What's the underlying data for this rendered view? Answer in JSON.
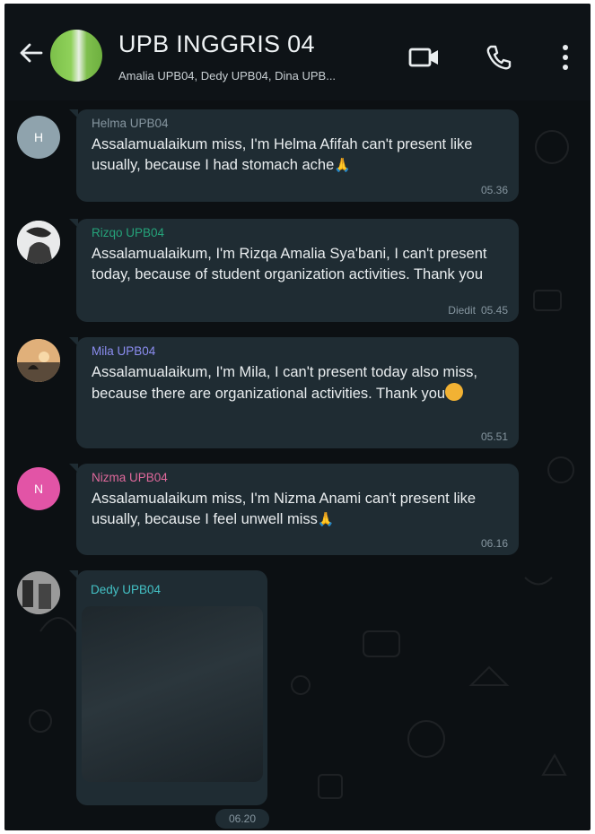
{
  "header": {
    "title": "UPB INGGRIS 04",
    "subtitle": "Amalia UPB04, Dedy UPB04, Dina UPB...",
    "icons": {
      "back": "back-arrow-icon",
      "video": "video-call-icon",
      "call": "voice-call-icon",
      "menu": "more-options-icon"
    }
  },
  "messages": [
    {
      "sender": "Helma UPB04",
      "sender_color": "#8696a0",
      "avatar_initial": "H",
      "avatar_color": "#8fa3ad",
      "text": "Assalamualaikum miss, I'm Helma Afifah can't present like usually, because I had stomach ache",
      "emoji": "🙏",
      "edited": "",
      "time": "05.36"
    },
    {
      "sender": "Rizqo UPB04",
      "sender_color": "#25a37a",
      "avatar_initial": "",
      "text": "Assalamualaikum, I'm Rizqa Amalia Sya'bani, I can't present today, because of student organization activities. Thank you",
      "edited": "Diedit",
      "time": "05.45"
    },
    {
      "sender": "Mila UPB04",
      "sender_color": "#8b8df0",
      "avatar_initial": "",
      "text": "Assalamualaikum, I'm Mila, I can't present today also miss, because there are organizational activities. Thank you",
      "emoji": "😊",
      "edited": "",
      "time": "05.51"
    },
    {
      "sender": "Nizma UPB04",
      "sender_color": "#e0699c",
      "avatar_initial": "N",
      "avatar_color": "#e254a6",
      "text": "Assalamualaikum miss, I'm Nizma Anami can't present like usually, because I feel unwell miss",
      "emoji": "🙏",
      "edited": "",
      "time": "06.16"
    }
  ],
  "media_message": {
    "sender": "Dedy UPB04",
    "sender_color": "#44c2c6",
    "time": "06.20"
  }
}
